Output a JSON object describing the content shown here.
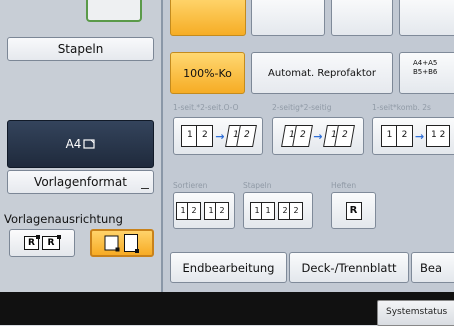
{
  "left": {
    "stapeln_label": "Stapeln",
    "paper_size_label": "A4",
    "vorlagenformat_label": "Vorlagenformat",
    "orientation_label": "Vorlagenausrichtung",
    "orientation_icon_letter": "R"
  },
  "right": {
    "reduce_enlarge_label": "100%-Ko",
    "auto_repro_label": "Automat. Reprofaktor",
    "preset_label_1": "A4+A5",
    "preset_label_2": "B5+B6",
    "duplex_labels": [
      "1-seit.*2-seit.O-O",
      "2-seitig*2-seitig",
      "1-seit*komb. 2s"
    ],
    "finishing_labels": [
      "Sortieren",
      "Stapeln",
      "Heften"
    ],
    "staple_icon_letter": "R",
    "tabs": [
      "Endbearbeitung",
      "Deck-/Trennblatt",
      "Bea"
    ]
  },
  "footer": {
    "system_status_label": "Systemstatus"
  }
}
